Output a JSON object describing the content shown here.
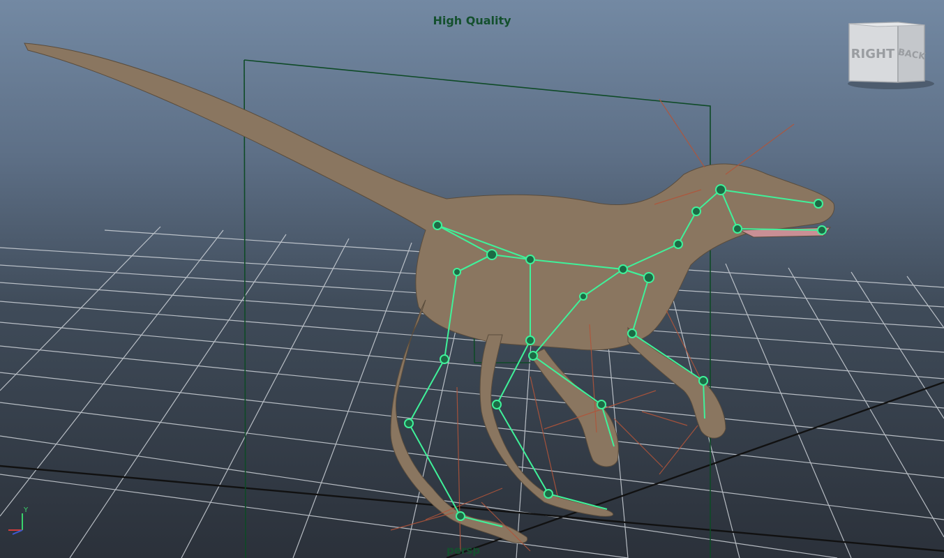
{
  "viewport": {
    "renderer_label": "High Quality",
    "camera_label": "persp"
  },
  "viewcube": {
    "faces": [
      "RIGHT",
      "BACK"
    ]
  },
  "axis_gizmo": {
    "up_axis": "Y"
  },
  "colors": {
    "bg_top": "#7389a3",
    "bg_bottom": "#2b313a",
    "hud_text": "#14502e",
    "joint": "#3ff29a",
    "dino_skin": "#8a7660",
    "grid": "#cfd4da",
    "grid_axis": "#111111",
    "bounding_box": "#0e4a26",
    "ik_lines": "#b0543a"
  }
}
